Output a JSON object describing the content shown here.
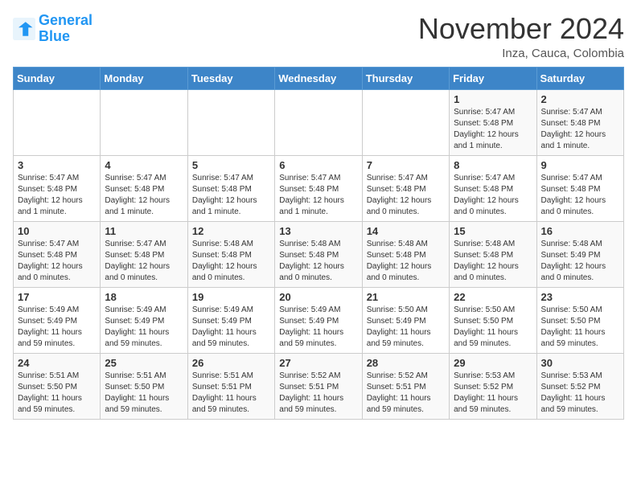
{
  "header": {
    "logo_line1": "General",
    "logo_line2": "Blue",
    "month_title": "November 2024",
    "location": "Inza, Cauca, Colombia"
  },
  "weekdays": [
    "Sunday",
    "Monday",
    "Tuesday",
    "Wednesday",
    "Thursday",
    "Friday",
    "Saturday"
  ],
  "weeks": [
    [
      {
        "day": "",
        "info": ""
      },
      {
        "day": "",
        "info": ""
      },
      {
        "day": "",
        "info": ""
      },
      {
        "day": "",
        "info": ""
      },
      {
        "day": "",
        "info": ""
      },
      {
        "day": "1",
        "info": "Sunrise: 5:47 AM\nSunset: 5:48 PM\nDaylight: 12 hours and 1 minute."
      },
      {
        "day": "2",
        "info": "Sunrise: 5:47 AM\nSunset: 5:48 PM\nDaylight: 12 hours and 1 minute."
      }
    ],
    [
      {
        "day": "3",
        "info": "Sunrise: 5:47 AM\nSunset: 5:48 PM\nDaylight: 12 hours and 1 minute."
      },
      {
        "day": "4",
        "info": "Sunrise: 5:47 AM\nSunset: 5:48 PM\nDaylight: 12 hours and 1 minute."
      },
      {
        "day": "5",
        "info": "Sunrise: 5:47 AM\nSunset: 5:48 PM\nDaylight: 12 hours and 1 minute."
      },
      {
        "day": "6",
        "info": "Sunrise: 5:47 AM\nSunset: 5:48 PM\nDaylight: 12 hours and 1 minute."
      },
      {
        "day": "7",
        "info": "Sunrise: 5:47 AM\nSunset: 5:48 PM\nDaylight: 12 hours and 0 minutes."
      },
      {
        "day": "8",
        "info": "Sunrise: 5:47 AM\nSunset: 5:48 PM\nDaylight: 12 hours and 0 minutes."
      },
      {
        "day": "9",
        "info": "Sunrise: 5:47 AM\nSunset: 5:48 PM\nDaylight: 12 hours and 0 minutes."
      }
    ],
    [
      {
        "day": "10",
        "info": "Sunrise: 5:47 AM\nSunset: 5:48 PM\nDaylight: 12 hours and 0 minutes."
      },
      {
        "day": "11",
        "info": "Sunrise: 5:47 AM\nSunset: 5:48 PM\nDaylight: 12 hours and 0 minutes."
      },
      {
        "day": "12",
        "info": "Sunrise: 5:48 AM\nSunset: 5:48 PM\nDaylight: 12 hours and 0 minutes."
      },
      {
        "day": "13",
        "info": "Sunrise: 5:48 AM\nSunset: 5:48 PM\nDaylight: 12 hours and 0 minutes."
      },
      {
        "day": "14",
        "info": "Sunrise: 5:48 AM\nSunset: 5:48 PM\nDaylight: 12 hours and 0 minutes."
      },
      {
        "day": "15",
        "info": "Sunrise: 5:48 AM\nSunset: 5:48 PM\nDaylight: 12 hours and 0 minutes."
      },
      {
        "day": "16",
        "info": "Sunrise: 5:48 AM\nSunset: 5:49 PM\nDaylight: 12 hours and 0 minutes."
      }
    ],
    [
      {
        "day": "17",
        "info": "Sunrise: 5:49 AM\nSunset: 5:49 PM\nDaylight: 11 hours and 59 minutes."
      },
      {
        "day": "18",
        "info": "Sunrise: 5:49 AM\nSunset: 5:49 PM\nDaylight: 11 hours and 59 minutes."
      },
      {
        "day": "19",
        "info": "Sunrise: 5:49 AM\nSunset: 5:49 PM\nDaylight: 11 hours and 59 minutes."
      },
      {
        "day": "20",
        "info": "Sunrise: 5:49 AM\nSunset: 5:49 PM\nDaylight: 11 hours and 59 minutes."
      },
      {
        "day": "21",
        "info": "Sunrise: 5:50 AM\nSunset: 5:49 PM\nDaylight: 11 hours and 59 minutes."
      },
      {
        "day": "22",
        "info": "Sunrise: 5:50 AM\nSunset: 5:50 PM\nDaylight: 11 hours and 59 minutes."
      },
      {
        "day": "23",
        "info": "Sunrise: 5:50 AM\nSunset: 5:50 PM\nDaylight: 11 hours and 59 minutes."
      }
    ],
    [
      {
        "day": "24",
        "info": "Sunrise: 5:51 AM\nSunset: 5:50 PM\nDaylight: 11 hours and 59 minutes."
      },
      {
        "day": "25",
        "info": "Sunrise: 5:51 AM\nSunset: 5:50 PM\nDaylight: 11 hours and 59 minutes."
      },
      {
        "day": "26",
        "info": "Sunrise: 5:51 AM\nSunset: 5:51 PM\nDaylight: 11 hours and 59 minutes."
      },
      {
        "day": "27",
        "info": "Sunrise: 5:52 AM\nSunset: 5:51 PM\nDaylight: 11 hours and 59 minutes."
      },
      {
        "day": "28",
        "info": "Sunrise: 5:52 AM\nSunset: 5:51 PM\nDaylight: 11 hours and 59 minutes."
      },
      {
        "day": "29",
        "info": "Sunrise: 5:53 AM\nSunset: 5:52 PM\nDaylight: 11 hours and 59 minutes."
      },
      {
        "day": "30",
        "info": "Sunrise: 5:53 AM\nSunset: 5:52 PM\nDaylight: 11 hours and 59 minutes."
      }
    ]
  ]
}
